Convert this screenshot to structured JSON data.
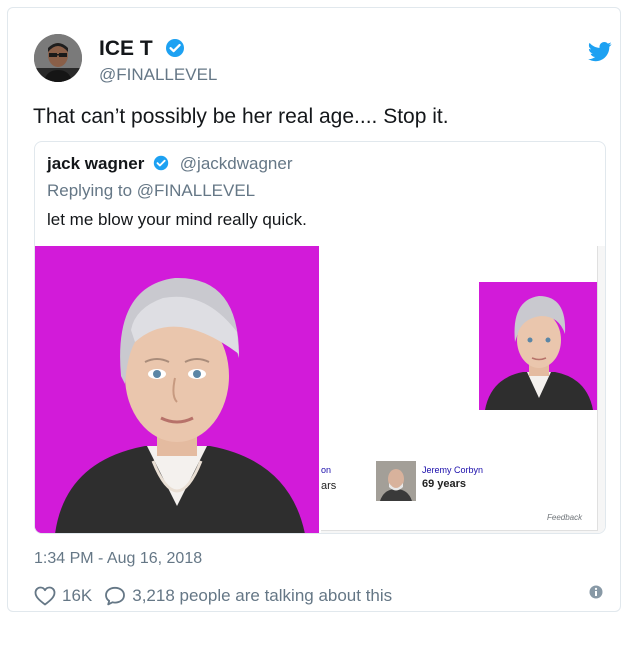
{
  "tweet": {
    "author_name": "ICE T",
    "author_handle": "@FINALLEVEL",
    "text": "That can’t possibly be her real age.... Stop it.",
    "timestamp": "1:34 PM - Aug 16, 2018",
    "likes": "16K",
    "talking": "3,218 people are talking about this"
  },
  "quoted": {
    "author_name": "jack wagner",
    "author_handle": "@jackdwagner",
    "reply_to": "Replying to @FINALLEVEL",
    "text": "let me blow your mind really quick."
  },
  "screenshot": {
    "cut_label": "on",
    "cut_value": "ars",
    "person_name": "Jeremy Corbyn",
    "person_age": "69 years",
    "feedback": "Feedback"
  },
  "colors": {
    "verified_blue": "#1da1f2",
    "magenta_bg": "#d21bd9",
    "text_secondary": "#657786"
  },
  "icons": [
    "verified-icon",
    "twitter-bird-icon",
    "heart-icon",
    "reply-bubble-icon",
    "info-icon"
  ]
}
